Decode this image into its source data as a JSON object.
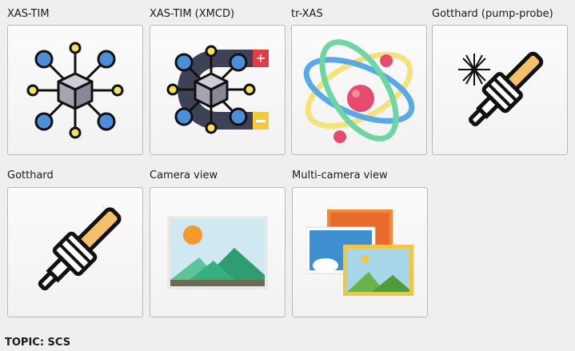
{
  "tiles": [
    {
      "label": "XAS-TIM",
      "icon": "molecule-network-icon"
    },
    {
      "label": "XAS-TIM (XMCD)",
      "icon": "magnet-molecule-icon"
    },
    {
      "label": "tr-XAS",
      "icon": "atom-icon"
    },
    {
      "label": "Gotthard (pump-probe)",
      "icon": "laser-detector-icon"
    },
    {
      "label": "Gotthard",
      "icon": "detector-stick-icon"
    },
    {
      "label": "Camera view",
      "icon": "landscape-image-icon"
    },
    {
      "label": "Multi-camera view",
      "icon": "multiple-images-icon"
    }
  ],
  "footer": {
    "topic": "TOPIC: SCS"
  },
  "colors": {
    "blue": "#4a8fd8",
    "yellow": "#f6e15a",
    "cube": "#a9a3b1",
    "magnet_dark": "#3d4256",
    "magnet_red": "#e23b43",
    "magnet_yellow": "#f3c93a",
    "atom_green": "#6fd6a3",
    "atom_blue": "#59a8e8",
    "atom_yellow": "#f6e27a",
    "atom_pink": "#e84a6e",
    "detector_orange": "#f4c069"
  }
}
